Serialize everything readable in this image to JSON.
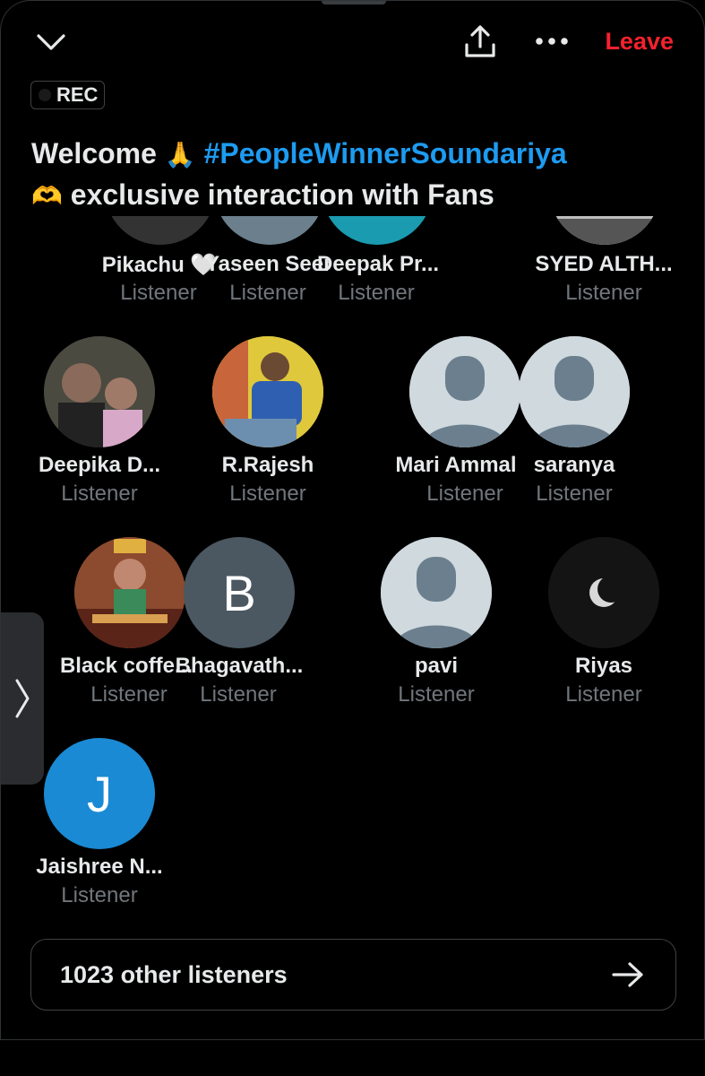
{
  "header": {
    "leave_label": "Leave",
    "rec_label": "REC"
  },
  "title": {
    "prefix": "Welcome",
    "emoji_pray": "🙏",
    "hashtag": "#PeopleWinnerSoundariya",
    "emoji_heart_hands": "🫶",
    "suffix": "exclusive interaction with Fans"
  },
  "participants": [
    {
      "name": "Pikachu 🤍",
      "role": "Listener"
    },
    {
      "name": "Yaseen Seen",
      "role": "Listener"
    },
    {
      "name": "Deepak Pr...",
      "role": "Listener"
    },
    {
      "name": "SYED ALTH...",
      "role": "Listener"
    },
    {
      "name": "Deepika D...",
      "role": "Listener"
    },
    {
      "name": "R.Rajesh",
      "role": "Listener"
    },
    {
      "name": "Mari Ammal",
      "role": "Listener"
    },
    {
      "name": "saranya",
      "role": "Listener"
    },
    {
      "name": "Black coffe...",
      "role": "Listener"
    },
    {
      "name": "Bhagavath...",
      "role": "Listener",
      "initial": "B"
    },
    {
      "name": "pavi",
      "role": "Listener"
    },
    {
      "name": "Riyas",
      "role": "Listener"
    },
    {
      "name": "Jaishree N...",
      "role": "Listener",
      "initial": "J"
    }
  ],
  "other_listeners_label": "1023 other listeners",
  "colors": {
    "accent": "#1d9bf0",
    "leave": "#f4212e",
    "muted": "#71767b"
  }
}
